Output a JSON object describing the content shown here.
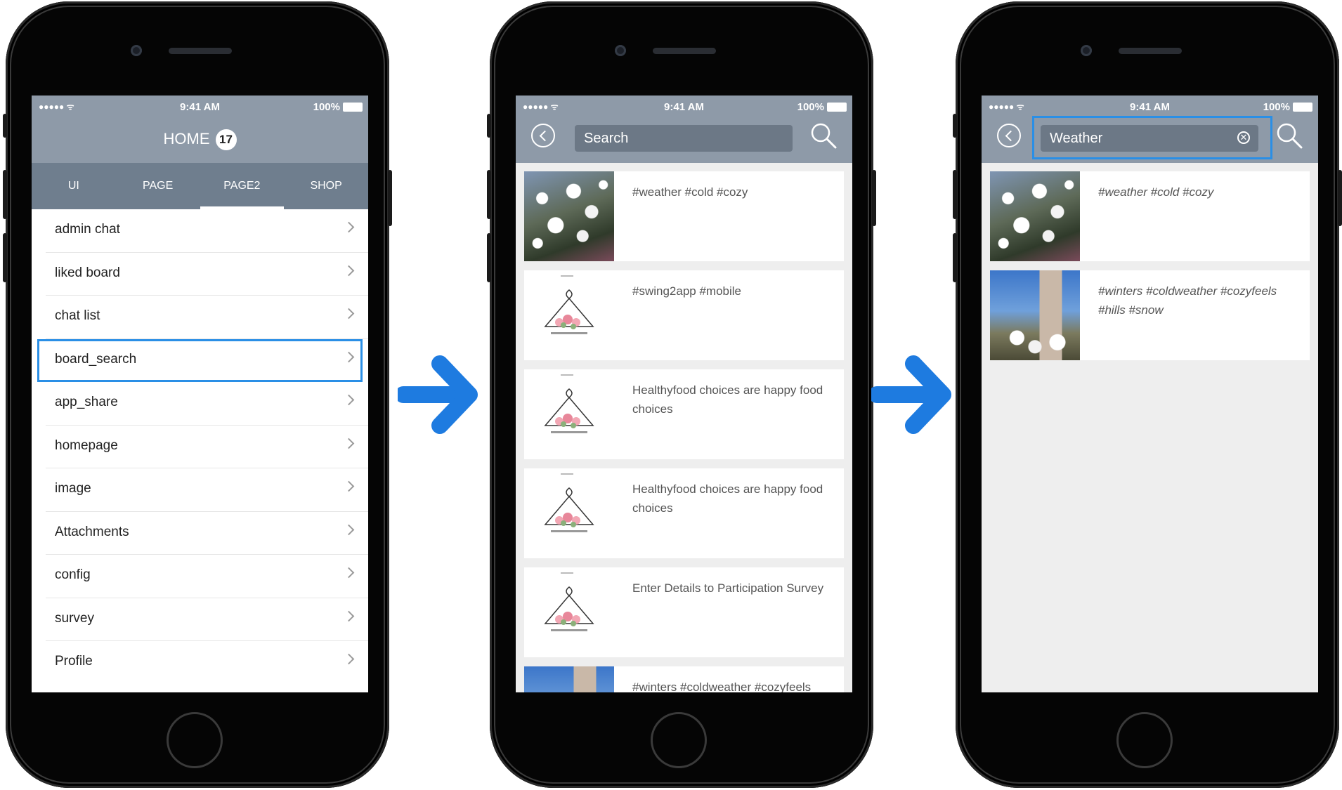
{
  "status_bar": {
    "signal": "●●●●● ᯤ",
    "time": "9:41 AM",
    "battery": "100%"
  },
  "phone1": {
    "title": "HOME",
    "badge": "17",
    "tabs": [
      "UI",
      "PAGE",
      "PAGE2",
      "SHOP"
    ],
    "active_tab": "PAGE2",
    "menu": [
      {
        "label": "admin chat"
      },
      {
        "label": "liked board"
      },
      {
        "label": "chat list"
      },
      {
        "label": "board_search",
        "highlighted": true
      },
      {
        "label": "app_share"
      },
      {
        "label": "homepage"
      },
      {
        "label": "image"
      },
      {
        "label": "Attachments"
      },
      {
        "label": "config"
      },
      {
        "label": "survey"
      },
      {
        "label": "Profile"
      }
    ]
  },
  "phone2": {
    "search_placeholder": "Search",
    "results": [
      {
        "text": "#weather #cold #cozy",
        "thumb": "blossom-photo"
      },
      {
        "text": "#swing2app #mobile",
        "thumb": "hanger-logo"
      },
      {
        "text": "Healthyfood choices are happy food choices",
        "thumb": "hanger-logo"
      },
      {
        "text": "Healthyfood choices are happy food choices",
        "thumb": "hanger-logo"
      },
      {
        "text": "Enter Details to Participation Survey",
        "thumb": "hanger-logo"
      },
      {
        "text": "#winters #coldweather #cozyfeels",
        "thumb": "building-photo"
      }
    ]
  },
  "phone3": {
    "search_value": "Weather",
    "results": [
      {
        "text": "#weather #cold #cozy",
        "thumb": "blossom-photo"
      },
      {
        "text": "#winters #coldweather #cozyfeels #hills #snow",
        "thumb": "building-photo"
      }
    ]
  },
  "colors": {
    "header_bg": "#8e9aa8",
    "tabs_bg": "#6f7e8e",
    "highlight": "#2a8fe6",
    "arrow": "#1e7be0"
  },
  "icons": [
    "back-icon",
    "search-icon",
    "clear-icon",
    "chevron-right-icon",
    "arrow-right-icon"
  ]
}
